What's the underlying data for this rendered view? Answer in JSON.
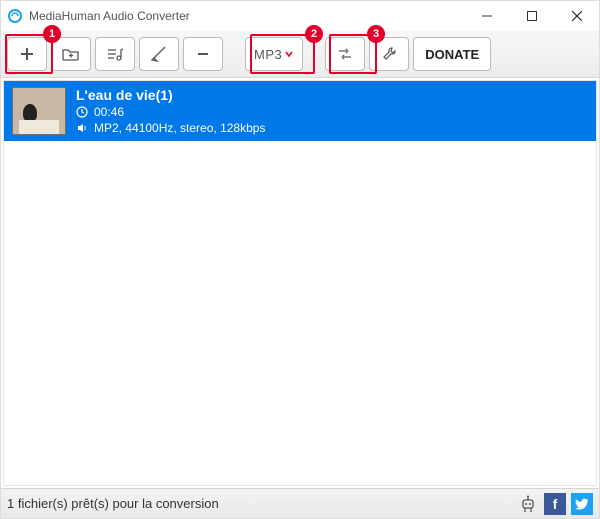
{
  "window": {
    "title": "MediaHuman Audio Converter"
  },
  "toolbar": {
    "format_label": "MP3",
    "donate_label": "DONATE"
  },
  "annotations": {
    "badge1": "1",
    "badge2": "2",
    "badge3": "3"
  },
  "track": {
    "title": "L'eau de vie(1)",
    "duration": "00:46",
    "details": "MP2, 44100Hz, stereo, 128kbps"
  },
  "statusbar": {
    "text": "1 fichier(s) prêt(s) pour la conversion"
  },
  "social": {
    "fb": "f",
    "tw": "t"
  }
}
